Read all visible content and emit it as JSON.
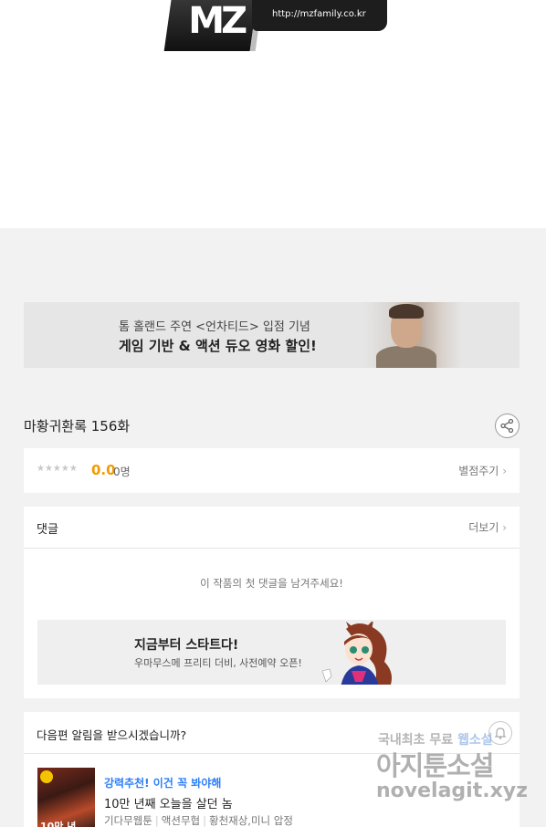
{
  "logo": {
    "mark": "MZ",
    "url_text": "http://mzfamily.co.kr"
  },
  "ad": {
    "line1": "톰 홀랜드 주연 <언차티드> 입점 기념",
    "line2": "게임 기반 & 액션 듀오 영화 할인!"
  },
  "episode": {
    "title": "마황귀환록 156화"
  },
  "rating": {
    "stars": "★★★★★",
    "score": "0.0",
    "count": "0명",
    "rate_link": "별점주기"
  },
  "comments": {
    "title": "댓글",
    "more_link": "더보기",
    "empty_message": "이 작품의 첫 댓글을 남겨주세요!",
    "promo_title": "지금부터 스타트다!",
    "promo_sub": "우마무스메 프리티 더비, 사전예약 오픈!"
  },
  "notify": {
    "title": "다음편 알림을 받으시겠습니까?"
  },
  "recommendation": {
    "tag": "강력추천! 이건 꼭 봐야해",
    "title": "10만 년째 오늘을 살던 놈",
    "thumb_text": "10만 년",
    "meta": [
      "기다무웹툰",
      "액션무협",
      "황천재상,미니 압정"
    ]
  },
  "watermark": {
    "line1_a": "국내최초 무료",
    "line1_b": "웹소설",
    "line2": "아지툰소설",
    "line3": "novelagit.xyz"
  },
  "colors": {
    "score": "#f29b00",
    "tag": "#2d7ff9",
    "page_bg": "#f2f2f2"
  }
}
